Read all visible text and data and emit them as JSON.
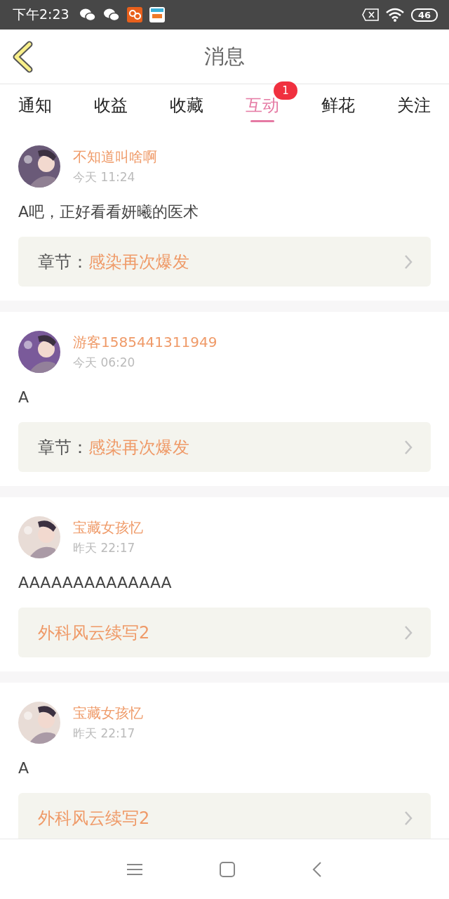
{
  "status_bar": {
    "time": "下午2:23",
    "battery": "46"
  },
  "header": {
    "title": "消息"
  },
  "tabs": [
    {
      "label": "通知",
      "selected": false
    },
    {
      "label": "收益",
      "selected": false
    },
    {
      "label": "收藏",
      "selected": false
    },
    {
      "label": "互动",
      "selected": true,
      "badge": "1"
    },
    {
      "label": "鲜花",
      "selected": false
    },
    {
      "label": "关注",
      "selected": false
    }
  ],
  "messages": [
    {
      "user": "不知道叫啥啊",
      "time": "今天 11:24",
      "text": "A吧，正好看看妍曦的医术",
      "link": {
        "prefix": "章节：",
        "title": "感染再次爆发"
      }
    },
    {
      "user": "游客1585441311949",
      "time": "今天 06:20",
      "text": "A",
      "link": {
        "prefix": "章节：",
        "title": "感染再次爆发"
      }
    },
    {
      "user": "宝藏女孩忆",
      "time": "昨天 22:17",
      "text": "AAAAAAAAAAAAAA",
      "link": {
        "title": "外科风云续写2"
      }
    },
    {
      "user": "宝藏女孩忆",
      "time": "昨天 22:17",
      "text": "A",
      "link": {
        "title": "外科风云续写2"
      }
    }
  ]
}
